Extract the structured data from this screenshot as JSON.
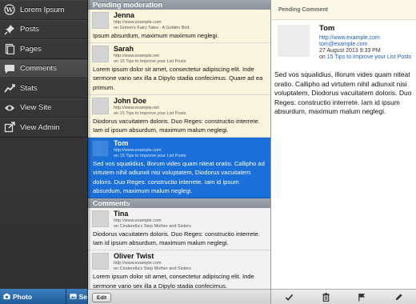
{
  "sidebar": {
    "items": [
      {
        "label": "Lorem Ipsum",
        "icon": "wordpress-icon"
      },
      {
        "label": "Posts",
        "icon": "pushpin-icon"
      },
      {
        "label": "Pages",
        "icon": "page-icon"
      },
      {
        "label": "Comments",
        "icon": "speech-bubble-icon"
      },
      {
        "label": "Stats",
        "icon": "stats-chart-icon"
      },
      {
        "label": "View Site",
        "icon": "eye-icon"
      },
      {
        "label": "View Admin",
        "icon": "external-link-icon"
      }
    ],
    "bottom": {
      "photo_label": "Photo",
      "second_label": "Se"
    }
  },
  "list": {
    "pending_header": "Pending moderation",
    "comments_header": "Comments",
    "pending": [
      {
        "name": "Jenna",
        "url": "http://www.example.com",
        "post": "on Grimm's Fairy Tales - A Golden Bird",
        "body": "Ipsum absurdum, maximum maximum neglegi."
      },
      {
        "name": "Sarah",
        "url": "http://www.example.net",
        "post": "on 15 Tips to Improve your List Posts",
        "body": "Lorem ipsum dolor sit amet, consectetur adipiscing elit. Inde sermone vario sex illa a Dipylo stadia confecimus. Quare ad ea primum."
      },
      {
        "name": "John Doe",
        "url": "http://www.example.net",
        "post": "on 15 Tips to Improve your List Posts",
        "body": "Diodorus vacuitatem doloris. Duo Reges: constructio interrete. Iam id ipsum absurdum, maximum malum neglegi."
      },
      {
        "name": "Tom",
        "url": "http://www.example.com",
        "post": "on 15 Tips to Improve your List Posts",
        "body": "Sed vos squalidius, illorum vides quam niteat oratio. Callipho ad virtutem nihil adiunxit nisi voluptatem, Diodorus vacuitatem doloris. Duo Reges: constructio interrete. Iam id ipsum absurdum, maximum malum neglegi."
      }
    ],
    "comments": [
      {
        "name": "Tina",
        "url": "http://www.example.com",
        "post": "on Cinderella's Step Mother and Sisters",
        "body": "Diodorus vacuitatem doloris. Duo Reges: constructio interrete. Iam id ipsum absurdum, maximum malum neglegi."
      },
      {
        "name": "Oliver Twist",
        "url": "http://www.example.com",
        "post": "on Cinderella's Step Mother and Sisters",
        "body": "Lorem ipsum dolor sit amet, consectetur adipiscing elit. Inde sermone vario sex illa a Dipylo stadia confecimus."
      }
    ],
    "edit_label": "Edit"
  },
  "detail": {
    "title": "Pending Comment",
    "name": "Tom",
    "url": "http://www.example.com",
    "email": "tom@example.com",
    "date": "27 August 2013 9:33 PM",
    "post_prefix": "on",
    "post_title": "15 Tips to Improve your List Posts",
    "body": "Sed vos squalidius, illorum vides quam niteat oratio. Callipho ad virtutem nihil adiunxit nisi voluptatem, Diodorus vacuitatem doloris. Duo Reges: constructio interrete. Iam id ipsum absurdum, maximum malum neglegi.",
    "toolbar": [
      "approve-check-icon",
      "trash-icon",
      "spam-flag-icon",
      "edit-pencil-icon"
    ]
  },
  "colors": {
    "selected": "#1a6fd8",
    "pending_bg": "#f8f5dc",
    "link": "#1a5fc2",
    "section_header": "#8a929b"
  }
}
